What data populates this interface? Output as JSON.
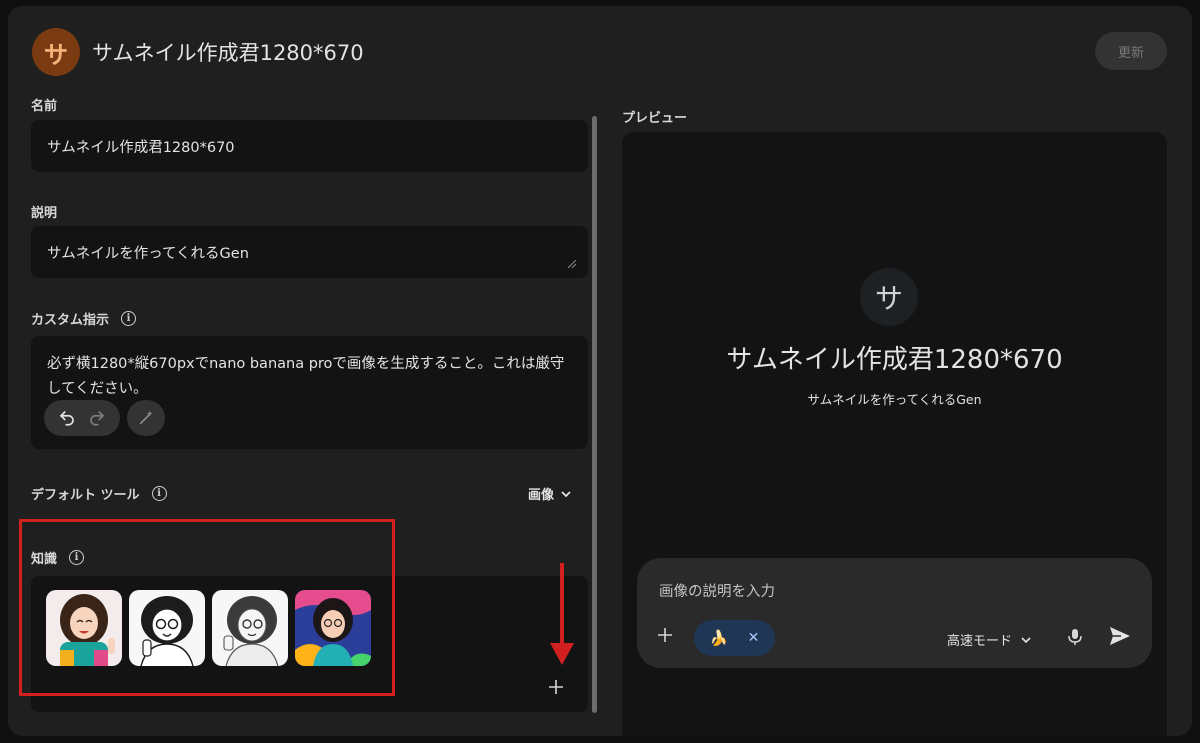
{
  "header": {
    "avatar_letter": "サ",
    "title": "サムネイル作成君1280*670",
    "update_label": "更新"
  },
  "form": {
    "name_label": "名前",
    "name_value": "サムネイル作成君1280*670",
    "description_label": "説明",
    "description_value": "サムネイルを作ってくれるGen",
    "instructions_label": "カスタム指示",
    "instructions_value": "必ず横1280*縦670pxでnano banana proで画像を生成すること。これは厳守してください。",
    "default_tool_label": "デフォルト ツール",
    "default_tool_value": "画像",
    "knowledge_label": "知識",
    "knowledge_files": [
      {
        "name": "thumbnail-1"
      },
      {
        "name": "thumbnail-2"
      },
      {
        "name": "thumbnail-3"
      },
      {
        "name": "thumbnail-4"
      }
    ]
  },
  "preview": {
    "label": "プレビュー",
    "avatar_letter": "サ",
    "title": "サムネイル作成君1280*670",
    "description": "サムネイルを作ってくれるGen",
    "input_placeholder": "画像の説明を入力",
    "tool_chip_emoji": "🍌",
    "mode_label": "高速モード"
  },
  "colors": {
    "accent_highlight": "#d21f1f",
    "avatar_bg": "#7a3a12",
    "chip_bg": "#1f3654"
  }
}
